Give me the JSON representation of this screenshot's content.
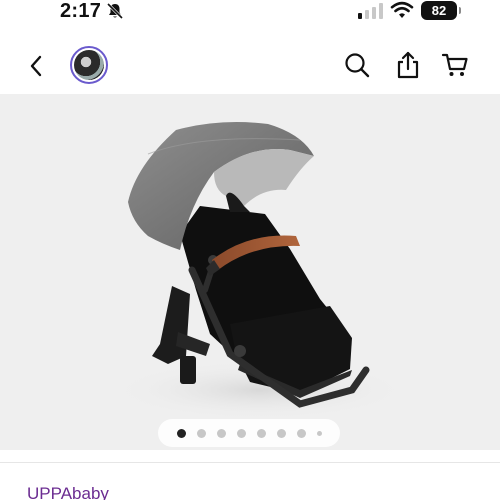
{
  "status": {
    "time": "2:17",
    "battery": "82"
  },
  "nav": {
    "back_icon": "chevron-left-icon",
    "avatar_icon": "store-avatar",
    "search_icon": "search-icon",
    "share_icon": "share-icon",
    "cart_icon": "cart-icon"
  },
  "gallery": {
    "image_count": 8,
    "active_index": 0
  },
  "product": {
    "brand": "UPPAbaby"
  },
  "colors": {
    "brand": "#6b2c91",
    "background": "#efefef",
    "leather": "#a0522d"
  }
}
